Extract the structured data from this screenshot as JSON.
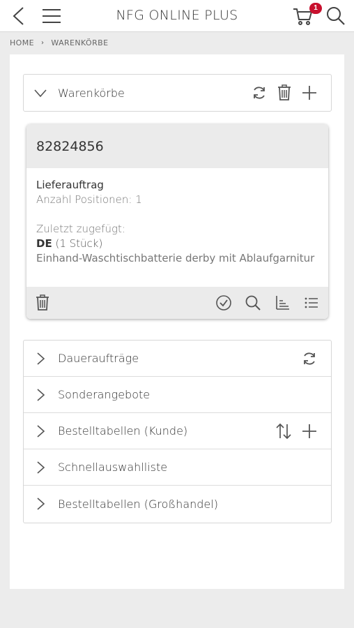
{
  "header": {
    "title": "NFG ONLINE PLUS",
    "cart_count": "1",
    "icons": [
      "back-icon",
      "menu-icon",
      "cart-icon",
      "search-icon"
    ]
  },
  "breadcrumb": {
    "home": "HOME",
    "separator": "›",
    "current": "WARENKÖRBE"
  },
  "warenkoerbe": {
    "label": "Warenkörbe",
    "icons": [
      "refresh-icon",
      "trash-icon",
      "plus-icon"
    ]
  },
  "cart": {
    "number": "82824856",
    "type": "Lieferauftrag",
    "positions": "Anzahl Positionen: 1",
    "last_added_label": "Zuletzt zugefügt:",
    "item_code": "DE",
    "item_qty": " (1 Stück)",
    "item_desc": "Einhand-Waschtischbatterie derby mit Ablaufgarnitur",
    "footer_icons": [
      "trash-icon",
      "check-circle-icon",
      "search-icon",
      "sort-icon",
      "list-icon"
    ]
  },
  "sections": [
    {
      "label": "Daueraufträge",
      "actions": [
        "refresh-icon"
      ]
    },
    {
      "label": "Sonderangebote",
      "actions": []
    },
    {
      "label": "Bestelltabellen (Kunde)",
      "actions": [
        "sort-arrows-icon",
        "plus-icon"
      ]
    },
    {
      "label": "Schnellauswahlliste",
      "actions": []
    },
    {
      "label": "Bestelltabellen (Großhandel)",
      "actions": []
    }
  ],
  "colors": {
    "badge": "#c8102e",
    "background": "#ececec",
    "card_header": "#ebebeb"
  }
}
